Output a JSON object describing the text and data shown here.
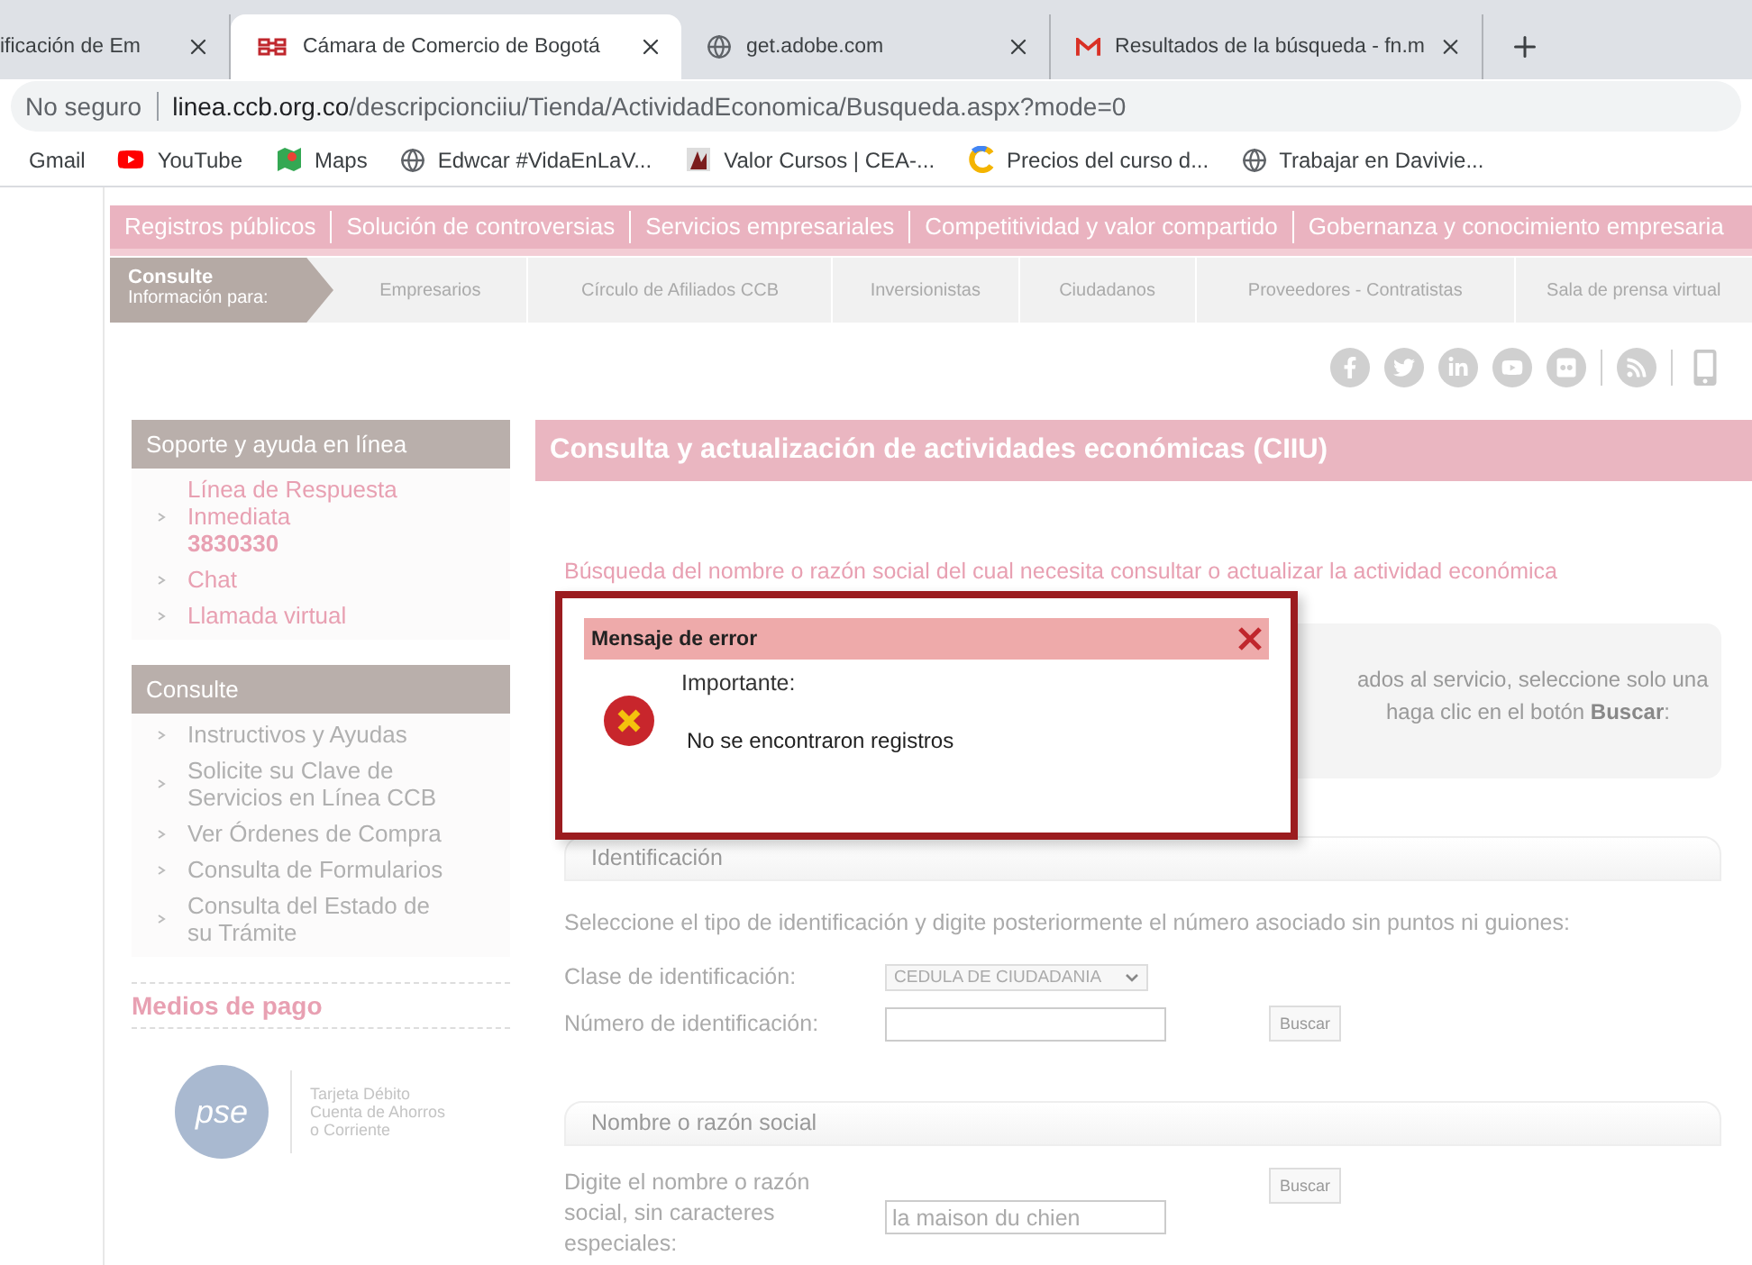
{
  "browser": {
    "tabs": [
      {
        "title": "ificación de Em",
        "selected": false
      },
      {
        "title": "Cámara de Comercio de Bogotá",
        "selected": true
      },
      {
        "title": "get.adobe.com",
        "selected": false
      },
      {
        "title": "Resultados de la búsqueda - fn.m",
        "selected": false
      }
    ],
    "address": {
      "security": "No seguro",
      "host": "linea.ccb.org.co",
      "path": "/descripcionciiu/Tienda/ActividadEconomica/Busqueda.aspx?mode=0"
    },
    "bookmarks": [
      "Gmail",
      "YouTube",
      "Maps",
      "Edwcar #VidaEnLaV...",
      "Valor Cursos | CEA-...",
      "Precios del curso d...",
      "Trabajar en Davivie..."
    ]
  },
  "main_nav": [
    "Registros públicos",
    "Solución de controversias",
    "Servicios empresariales",
    "Competitividad y valor compartido",
    "Gobernanza y conocimiento empresaria"
  ],
  "sub_nav": {
    "title": "Consulte",
    "subtitle": "Información para:",
    "items": [
      "Empresarios",
      "Círculo de Afiliados CCB",
      "Inversionistas",
      "Ciudadanos",
      "Proveedores - Contratistas",
      "Sala de prensa virtual"
    ]
  },
  "sidebar": {
    "support": {
      "title": "Soporte y ayuda en línea",
      "items": [
        {
          "label": "Línea de Respuesta Inmediata",
          "detail": "3830330"
        },
        {
          "label": "Chat"
        },
        {
          "label": "Llamada virtual"
        }
      ]
    },
    "consult": {
      "title": "Consulte",
      "items": [
        "Instructivos y Ayudas",
        "Solicite su Clave de Servicios en Línea CCB",
        "Ver Órdenes de Compra",
        "Consulta de Formularios",
        "Consulta del Estado de su Trámite"
      ]
    },
    "payments": {
      "title": "Medios de pago",
      "logo_text": "pse",
      "caption": [
        "Tarjeta Débito",
        "Cuenta de Ahorros",
        "o Corriente"
      ]
    }
  },
  "content": {
    "title": "Consulta y actualización de actividades económicas (CIIU)",
    "intro": "Búsqueda del nombre o razón social del cual necesita consultar o actualizar la actividad económica",
    "info_fragments": [
      "ados al servicio, seleccione solo una",
      "haga clic en el botón **Buscar**:"
    ],
    "identification": {
      "header": "Identificación",
      "instructions": "Seleccione el tipo de identificación y digite posteriormente el número asociado sin puntos ni guiones:",
      "type_label": "Clase de identificación:",
      "type_value": "CEDULA DE CIUDADANIA",
      "number_label": "Número de identificación:",
      "button": "Buscar"
    },
    "name_search": {
      "header": "Nombre o razón social",
      "label": "Digite el nombre o razón social, sin caracteres especiales:",
      "value": "la maison du chien",
      "button": "Buscar"
    }
  },
  "dialog": {
    "title": "Mensaje de error",
    "heading": "Importante:",
    "message": "No se encontraron registros"
  }
}
